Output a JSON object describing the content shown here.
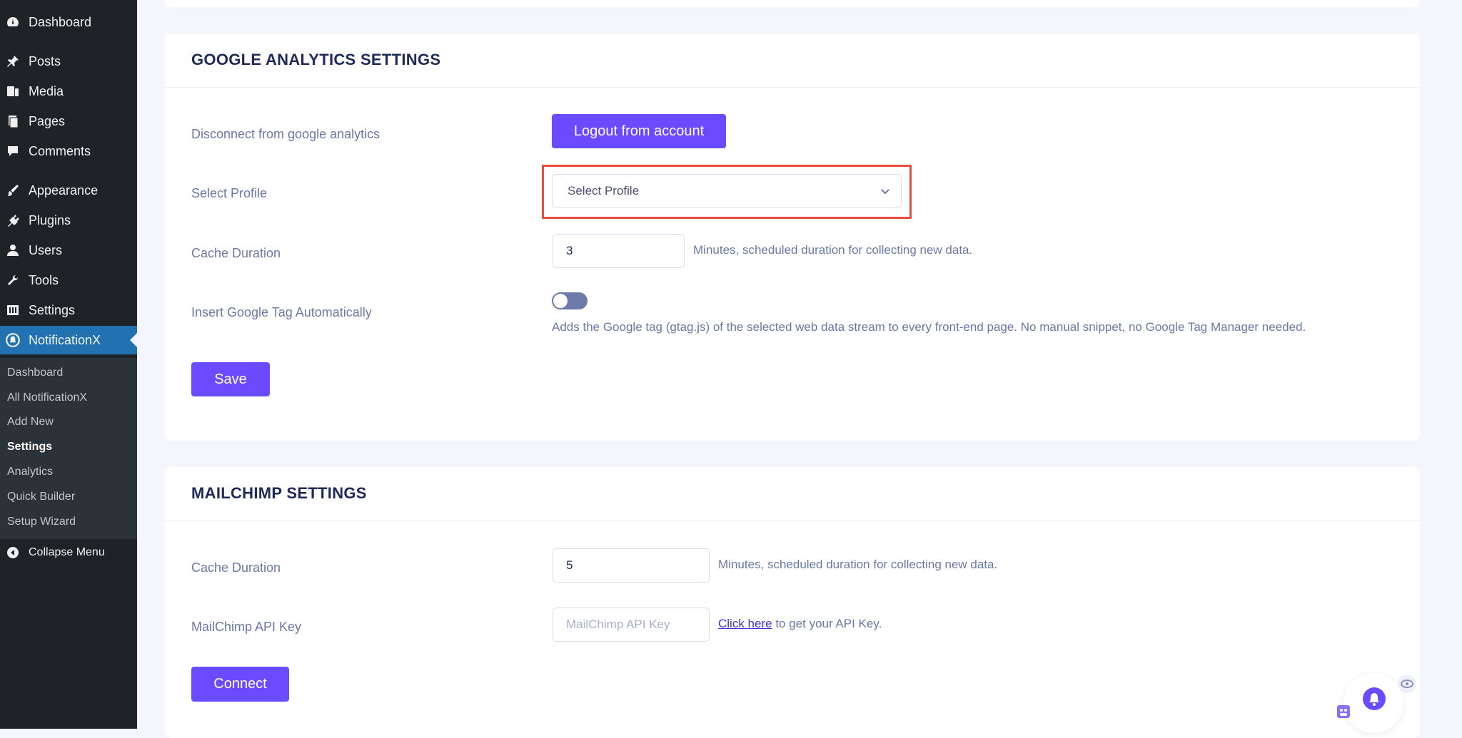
{
  "sidebar": {
    "items": [
      {
        "label": "Dashboard",
        "icon": "dashboard-icon"
      },
      {
        "label": "Posts",
        "icon": "pin-icon"
      },
      {
        "label": "Media",
        "icon": "media-icon"
      },
      {
        "label": "Pages",
        "icon": "pages-icon"
      },
      {
        "label": "Comments",
        "icon": "comment-icon"
      },
      {
        "label": "Appearance",
        "icon": "brush-icon"
      },
      {
        "label": "Plugins",
        "icon": "plugin-icon"
      },
      {
        "label": "Users",
        "icon": "user-icon"
      },
      {
        "label": "Tools",
        "icon": "wrench-icon"
      },
      {
        "label": "Settings",
        "icon": "settings-icon"
      },
      {
        "label": "NotificationX",
        "icon": "notificationx-icon"
      }
    ],
    "submenu": [
      "Dashboard",
      "All NotificationX",
      "Add New",
      "Settings",
      "Analytics",
      "Quick Builder",
      "Setup Wizard"
    ],
    "current_submenu": "Settings",
    "collapse_label": "Collapse Menu"
  },
  "google_analytics": {
    "title": "GOOGLE ANALYTICS SETTINGS",
    "disconnect_label": "Disconnect from google analytics",
    "logout_button": "Logout from account",
    "profile_label": "Select Profile",
    "profile_value": "Select Profile",
    "cache_label": "Cache Duration",
    "cache_value": "3",
    "cache_help": "Minutes, scheduled duration for collecting new data.",
    "tag_label": "Insert Google Tag Automatically",
    "tag_enabled": false,
    "tag_help": "Adds the Google tag (gtag.js) of the selected web data stream to every front-end page. No manual snippet, no Google Tag Manager needed.",
    "save_button": "Save"
  },
  "mailchimp": {
    "title": "MAILCHIMP SETTINGS",
    "cache_label": "Cache Duration",
    "cache_value": "5",
    "cache_help": "Minutes, scheduled duration for collecting new data.",
    "api_label": "MailChimp API Key",
    "api_placeholder": "MailChimp API Key",
    "api_link": "Click here",
    "api_help": " to get your API Key.",
    "connect_button": "Connect"
  },
  "colors": {
    "accent": "#6a4bff",
    "sidebar_bg": "#1d2327",
    "active_menu": "#2271b1",
    "highlight": "#e74c3c"
  }
}
